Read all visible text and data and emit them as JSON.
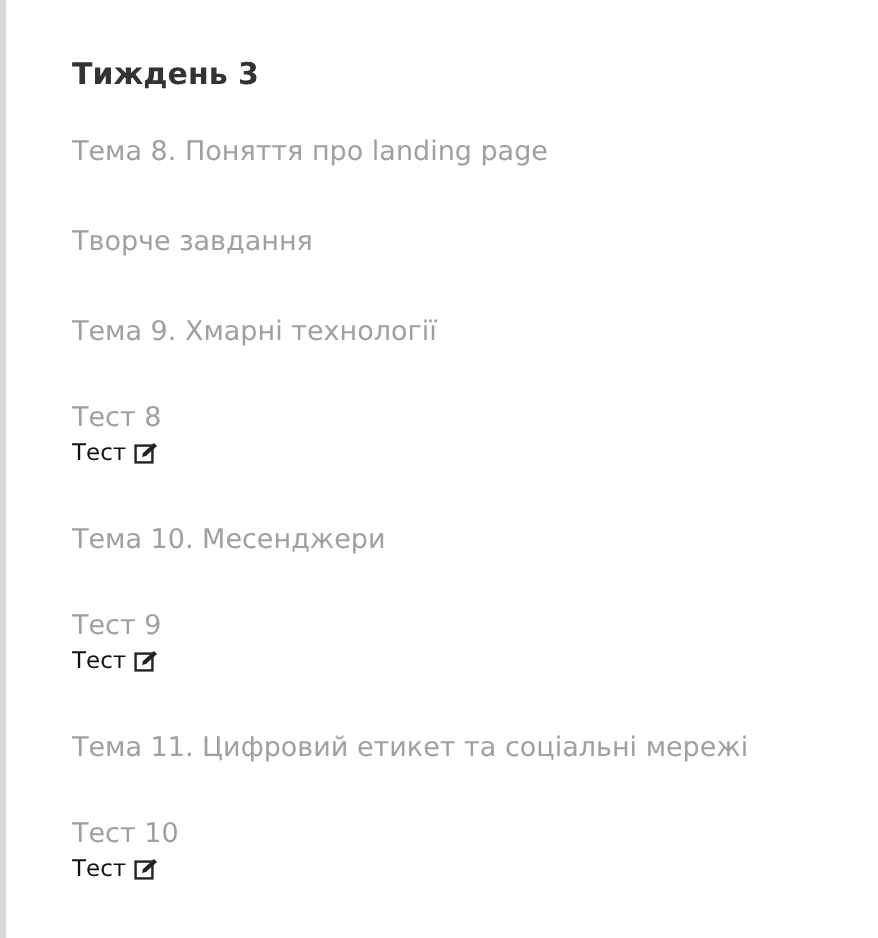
{
  "section": {
    "title": "Тиждень 3",
    "items": [
      {
        "kind": "topic",
        "label": "Тема 8. Поняття про landing page"
      },
      {
        "kind": "topic",
        "label": "Творче завдання"
      },
      {
        "kind": "topic",
        "label": "Тема 9. Хмарні технології"
      },
      {
        "kind": "test",
        "label": "Тест 8",
        "sublabel": "Тест"
      },
      {
        "kind": "topic",
        "label": "Тема 10. Месенджери"
      },
      {
        "kind": "test",
        "label": "Тест 9",
        "sublabel": "Тест"
      },
      {
        "kind": "topic",
        "label": "Тема 11. Цифровий етикет та соціальні мережі"
      },
      {
        "kind": "test",
        "label": "Тест 10",
        "sublabel": "Тест"
      }
    ]
  }
}
